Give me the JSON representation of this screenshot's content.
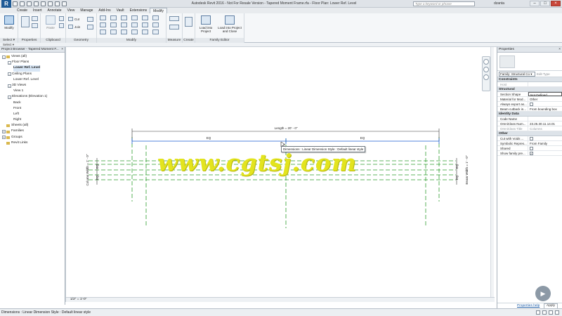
{
  "window": {
    "app_button": "R",
    "title": "Autodesk Revit 2016 - Not For Resale Version -   Tapered Moment Frame.rfa - Floor Plan: Lower Ref. Level",
    "search_placeholder": "Type a keyword or phrase",
    "user": "dzanta",
    "min": "–",
    "max": "□",
    "close": "×"
  },
  "tabs": [
    "Create",
    "Insert",
    "Annotate",
    "View",
    "Manage",
    "Add-Ins",
    "Vault",
    "Extensions",
    "Modify"
  ],
  "active_tab": "Modify",
  "ribbon": {
    "select_panel": "Select ▾",
    "properties_panel": "Properties",
    "clipboard_panel": "Clipboard",
    "geometry_panel": "Geometry",
    "modify_panel": "Modify",
    "measure_panel": "Measure",
    "create_panel": "Create",
    "family_editor_panel": "Family Editor",
    "modify_btn": "Modify",
    "paste_btn": "Paste",
    "cut_btn": "Cut",
    "join_btn": "Join",
    "load_project_btn": "Load into Project",
    "load_close_btn": "Load into Project and Close"
  },
  "project_browser": {
    "header": "Project Browser - Tapered Moment F...",
    "close": "×",
    "nodes": [
      {
        "label": "Views (all)",
        "toggle": "–",
        "depth": 0
      },
      {
        "label": "Floor Plans",
        "toggle": "–",
        "depth": 1
      },
      {
        "label": "Lower Ref. Level",
        "toggle": "",
        "depth": 2
      },
      {
        "label": "Ceiling Plans",
        "toggle": "–",
        "depth": 1
      },
      {
        "label": "Lower Ref. Level",
        "toggle": "",
        "depth": 2
      },
      {
        "label": "3D Views",
        "toggle": "–",
        "depth": 1
      },
      {
        "label": "View 1",
        "toggle": "",
        "depth": 2
      },
      {
        "label": "Elevations (Elevation 1)",
        "toggle": "–",
        "depth": 1
      },
      {
        "label": "Back",
        "toggle": "",
        "depth": 2
      },
      {
        "label": "Front",
        "toggle": "",
        "depth": 2
      },
      {
        "label": "Left",
        "toggle": "",
        "depth": 2
      },
      {
        "label": "Right",
        "toggle": "",
        "depth": 2
      },
      {
        "label": "Sheets (all)",
        "toggle": "",
        "depth": 0
      },
      {
        "label": "Families",
        "toggle": "+",
        "depth": 0
      },
      {
        "label": "Groups",
        "toggle": "+",
        "depth": 0
      },
      {
        "label": "Revit Links",
        "toggle": "",
        "depth": 0
      }
    ]
  },
  "canvas": {
    "watermark": "www.cgtsj.com",
    "tooltip": "Dimensions : Linear Dimension Style : Default linear style",
    "overall_dim": "Length = 20' - 0\"",
    "eq_left": "EQ",
    "eq_right": "EQ",
    "eq_small": "EQ",
    "left_label": "Column Width = 1' - 0\"",
    "right_label": "Beam Width = 1' - 0\"",
    "scale": "1/2\" = 1'-0\""
  },
  "properties": {
    "header": "Properties",
    "close": "×",
    "family_select": "Family: Structural Co ▾",
    "edit_type": "Edit Type",
    "groups": [
      {
        "name": "Constraints",
        "rows": [
          {
            "k": "Host",
            "v": "",
            "dim": true
          }
        ]
      },
      {
        "name": "Structural",
        "rows": [
          {
            "k": "Section Shape",
            "v": "Not Defined"
          },
          {
            "k": "Material for Mod...",
            "v": "Other"
          },
          {
            "k": "Always export as...",
            "v": "",
            "chk": true
          },
          {
            "k": "Beam cutback in...",
            "v": "From bounding box"
          }
        ]
      },
      {
        "name": "Identity Data",
        "rows": [
          {
            "k": "Code Name",
            "v": ""
          },
          {
            "k": "OmniClass Num...",
            "v": "23.25.30.11.14.01"
          },
          {
            "k": "OmniClass Title",
            "v": "Columns",
            "dim": true
          }
        ]
      },
      {
        "name": "Other",
        "rows": [
          {
            "k": "Cut with Voids ...",
            "v": "",
            "chk": true
          },
          {
            "k": "Symbolic Repres...",
            "v": "From Family"
          },
          {
            "k": "Shared",
            "v": "",
            "chk": true
          },
          {
            "k": "Show family pre...",
            "v": "",
            "chk": true,
            "checked": true
          }
        ]
      }
    ],
    "help_link": "Properties help",
    "apply": "Apply"
  },
  "status": "Dimensions : Linear Dimension Style : Default linear style",
  "colors": {
    "ref_plane_green": "#2f9e2f",
    "watermark": "#e3e41e",
    "revit_blue": "#1e5a96"
  }
}
